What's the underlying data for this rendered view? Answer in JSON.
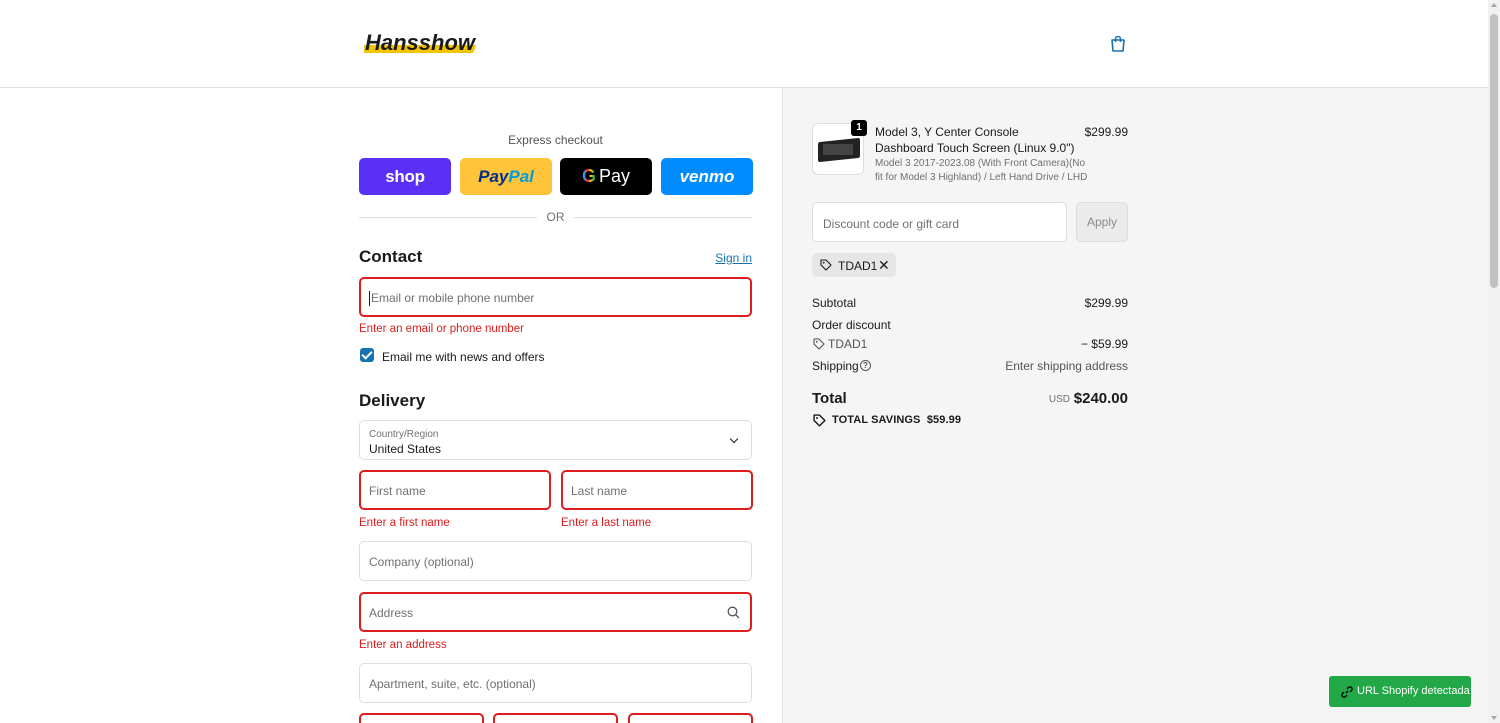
{
  "header": {
    "logo_text": "Hansshow"
  },
  "express": {
    "label": "Express checkout",
    "shop_label": "shop",
    "paypal_label_1": "Pay",
    "paypal_label_2": "Pal",
    "gpay_g": "G",
    "gpay_label": "Pay",
    "venmo_label": "venmo",
    "or_label": "OR"
  },
  "contact": {
    "title": "Contact",
    "signin_label": "Sign in",
    "email_placeholder": "Email or mobile phone number",
    "email_error": "Enter an email or phone number",
    "newsletter_label": "Email me with news and offers",
    "newsletter_checked": true
  },
  "delivery": {
    "title": "Delivery",
    "country_label": "Country/Region",
    "country_value": "United States",
    "first_name_placeholder": "First name",
    "first_name_error": "Enter a first name",
    "last_name_placeholder": "Last name",
    "last_name_error": "Enter a last name",
    "company_placeholder": "Company (optional)",
    "address_placeholder": "Address",
    "address_error": "Enter an address",
    "apartment_placeholder": "Apartment, suite, etc. (optional)"
  },
  "order": {
    "product_name": "Model 3, Y Center Console Dashboard Touch Screen (Linux 9.0\")",
    "product_variant": "Model 3 2017-2023.08 (With Front Camera)(No fit for Model 3 Highland) / Left Hand Drive / LHD",
    "product_price": "$299.99",
    "quantity": "1",
    "discount_placeholder": "Discount code or gift card",
    "apply_label": "Apply",
    "applied_code": "TDAD1",
    "subtotal_label": "Subtotal",
    "subtotal_value": "$299.99",
    "order_discount_label": "Order discount",
    "discount_code": "TDAD1",
    "discount_value": "− $59.99",
    "shipping_label": "Shipping",
    "shipping_value": "Enter shipping address",
    "total_label": "Total",
    "currency": "USD",
    "total_value": "$240.00",
    "savings_label": "TOTAL SAVINGS",
    "savings_value": "$59.99"
  },
  "extension": {
    "badge_label": "URL Shopify detectada"
  },
  "colors": {
    "accent": "#1773b0",
    "error": "#dd1d1d",
    "shop": "#5a31f4",
    "paypal": "#ffc439",
    "venmo": "#008cff",
    "badge": "#22a846"
  }
}
